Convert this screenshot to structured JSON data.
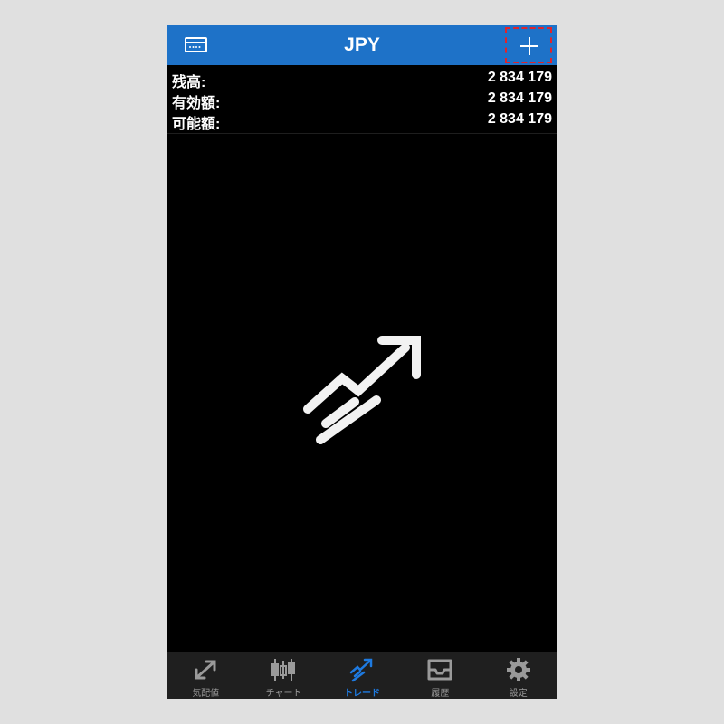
{
  "header": {
    "title": "JPY",
    "left_icon": "account-card-icon",
    "right_icon": "plus-icon"
  },
  "balance": {
    "rows": [
      {
        "label": "残高:",
        "value": "2 834 179"
      },
      {
        "label": "有効額:",
        "value": "2 834 179"
      },
      {
        "label": "可能額:",
        "value": "2 834 179"
      }
    ]
  },
  "empty_state": {
    "icon": "trade-trend-icon"
  },
  "tabs": [
    {
      "label": "気配値",
      "icon": "quotes-icon",
      "active": false
    },
    {
      "label": "チャート",
      "icon": "candlestick-icon",
      "active": false
    },
    {
      "label": "トレード",
      "icon": "trade-icon",
      "active": true
    },
    {
      "label": "履歴",
      "icon": "history-inbox-icon",
      "active": false
    },
    {
      "label": "設定",
      "icon": "gear-icon",
      "active": false
    }
  ],
  "colors": {
    "accent": "#1e72c8",
    "active_tab": "#1e7ae0",
    "inactive_tab": "#9a9a9a",
    "highlight": "#e0242b"
  }
}
